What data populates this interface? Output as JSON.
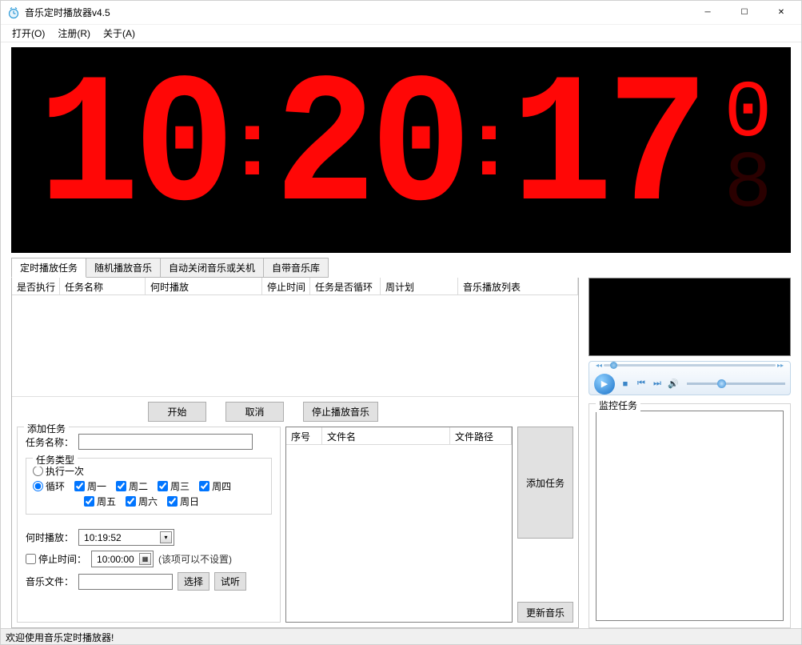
{
  "window": {
    "title": "音乐定时播放器v4.5"
  },
  "menu": {
    "open": "打开(O)",
    "register": "注册(R)",
    "about": "关于(A)"
  },
  "clock": {
    "h": "10",
    "m": "20",
    "s": "17",
    "sec_top": "0",
    "sec_bottom": "8"
  },
  "tabs": {
    "t1": "定时播放任务",
    "t2": "随机播放音乐",
    "t3": "自动关闭音乐或关机",
    "t4": "自带音乐库"
  },
  "table_headers": {
    "exec": "是否执行",
    "name": "任务名称",
    "when": "何时播放",
    "stop": "停止时间",
    "loop": "任务是否循环",
    "plan": "周计划",
    "list": "音乐播放列表"
  },
  "buttons": {
    "start": "开始",
    "cancel": "取消",
    "stop_music": "停止播放音乐",
    "select": "选择",
    "preview": "试听",
    "add_task": "添加任务",
    "update_music": "更新音乐"
  },
  "add_task": {
    "group_title": "添加任务",
    "name_label": "任务名称：",
    "type_group": "任务类型",
    "exec_once": "执行一次",
    "loop": "循环",
    "mon": "周一",
    "tue": "周二",
    "wed": "周三",
    "thu": "周四",
    "fri": "周五",
    "sat": "周六",
    "sun": "周日",
    "when_label": "何时播放：",
    "when_value": "10:19:52",
    "stop_label": "停止时间：",
    "stop_value": "10:00:00",
    "stop_hint": "(该项可以不设置)",
    "music_label": "音乐文件："
  },
  "file_headers": {
    "no": "序号",
    "name": "文件名",
    "path": "文件路径"
  },
  "monitor": {
    "title": "监控任务"
  },
  "status": "欢迎使用音乐定时播放器!"
}
